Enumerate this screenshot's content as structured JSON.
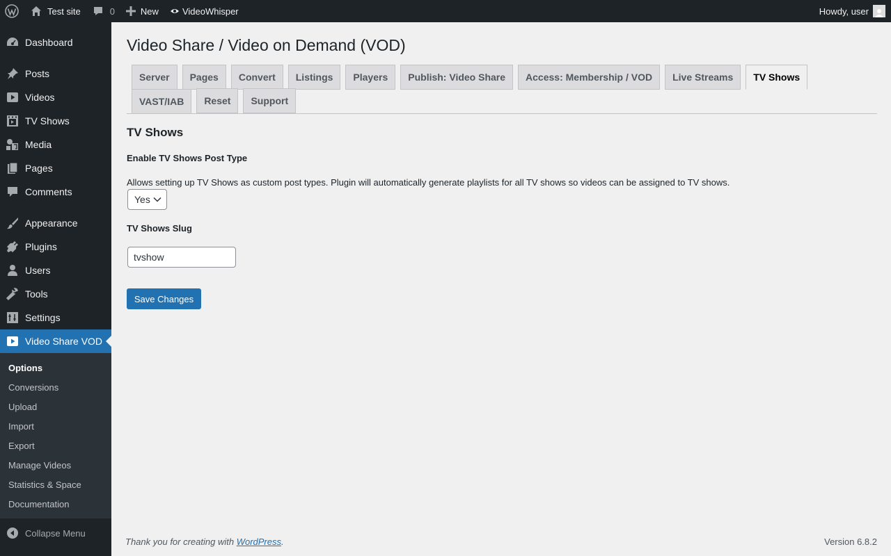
{
  "adminbar": {
    "site_name": "Test site",
    "comments_count": "0",
    "new_label": "New",
    "plugin_label": "VideoWhisper",
    "howdy": "Howdy, user"
  },
  "sidebar": {
    "items": [
      {
        "label": "Dashboard",
        "icon": "dashboard-icon"
      },
      {
        "label": "Posts",
        "icon": "pushpin-icon"
      },
      {
        "label": "Videos",
        "icon": "video-icon"
      },
      {
        "label": "TV Shows",
        "icon": "film-icon"
      },
      {
        "label": "Media",
        "icon": "media-icon"
      },
      {
        "label": "Pages",
        "icon": "pages-icon"
      },
      {
        "label": "Comments",
        "icon": "comment-icon"
      },
      {
        "label": "Appearance",
        "icon": "brush-icon"
      },
      {
        "label": "Plugins",
        "icon": "plugin-icon"
      },
      {
        "label": "Users",
        "icon": "user-icon"
      },
      {
        "label": "Tools",
        "icon": "wrench-icon"
      },
      {
        "label": "Settings",
        "icon": "settings-icon"
      },
      {
        "label": "Video Share VOD",
        "icon": "video-icon"
      }
    ],
    "submenu": [
      "Options",
      "Conversions",
      "Upload",
      "Import",
      "Export",
      "Manage Videos",
      "Statistics & Space",
      "Documentation"
    ],
    "collapse_label": "Collapse Menu"
  },
  "main": {
    "title": "Video Share / Video on Demand (VOD)",
    "tabs": [
      "Server",
      "Pages",
      "Convert",
      "Listings",
      "Players",
      "Publish: Video Share",
      "Access: Membership / VOD",
      "Live Streams",
      "TV Shows",
      "VAST/IAB",
      "Reset",
      "Support"
    ],
    "active_tab": "TV Shows",
    "section_title": "TV Shows",
    "enable_label": "Enable TV Shows Post Type",
    "enable_desc": "Allows setting up TV Shows as custom post types. Plugin will automatically generate playlists for all TV shows so videos can be assigned to TV shows.",
    "enable_value": "Yes",
    "slug_label": "TV Shows Slug",
    "slug_value": "tvshow",
    "save_label": "Save Changes"
  },
  "footer": {
    "thanks_prefix": "Thank you for creating with ",
    "wordpress_link": "WordPress",
    "thanks_suffix": ".",
    "version": "Version 6.8.2"
  },
  "colors": {
    "accent": "#2271b1",
    "adminbar": "#1d2327",
    "background": "#f0f0f1"
  }
}
